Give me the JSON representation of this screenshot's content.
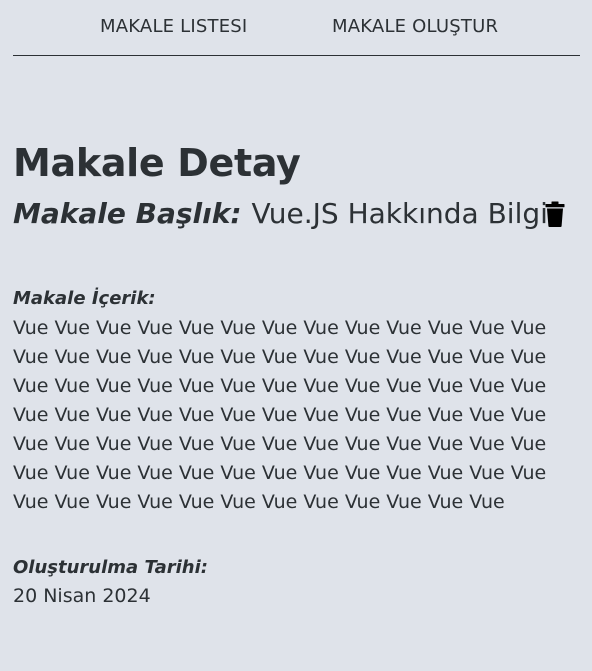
{
  "nav": {
    "list_label": "MAKALE LISTESI",
    "create_label": "MAKALE OLUŞTUR"
  },
  "detail": {
    "page_title": "Makale Detay",
    "title_label": "Makale Başlık:",
    "title_value": "Vue.JS Hakkında Bilgi",
    "delete_icon": "trash-icon",
    "content_label": "Makale İçerik:",
    "content_value": "Vue Vue Vue Vue Vue Vue Vue Vue Vue Vue Vue Vue Vue Vue Vue Vue Vue Vue Vue Vue Vue Vue Vue Vue Vue Vue Vue Vue Vue Vue Vue Vue Vue Vue Vue Vue Vue Vue Vue Vue Vue Vue Vue Vue Vue Vue Vue Vue Vue Vue Vue Vue Vue Vue Vue Vue Vue Vue Vue Vue Vue Vue Vue Vue Vue Vue Vue Vue Vue Vue Vue Vue Vue Vue Vue Vue Vue Vue Vue Vue Vue Vue Vue Vue Vue Vue Vue Vue Vue Vue",
    "date_label": "Oluşturulma Tarihi:",
    "date_value": "20 Nisan 2024"
  },
  "colors": {
    "background": "#dfe3ea",
    "text": "#2c3135",
    "icon": "#000000"
  }
}
